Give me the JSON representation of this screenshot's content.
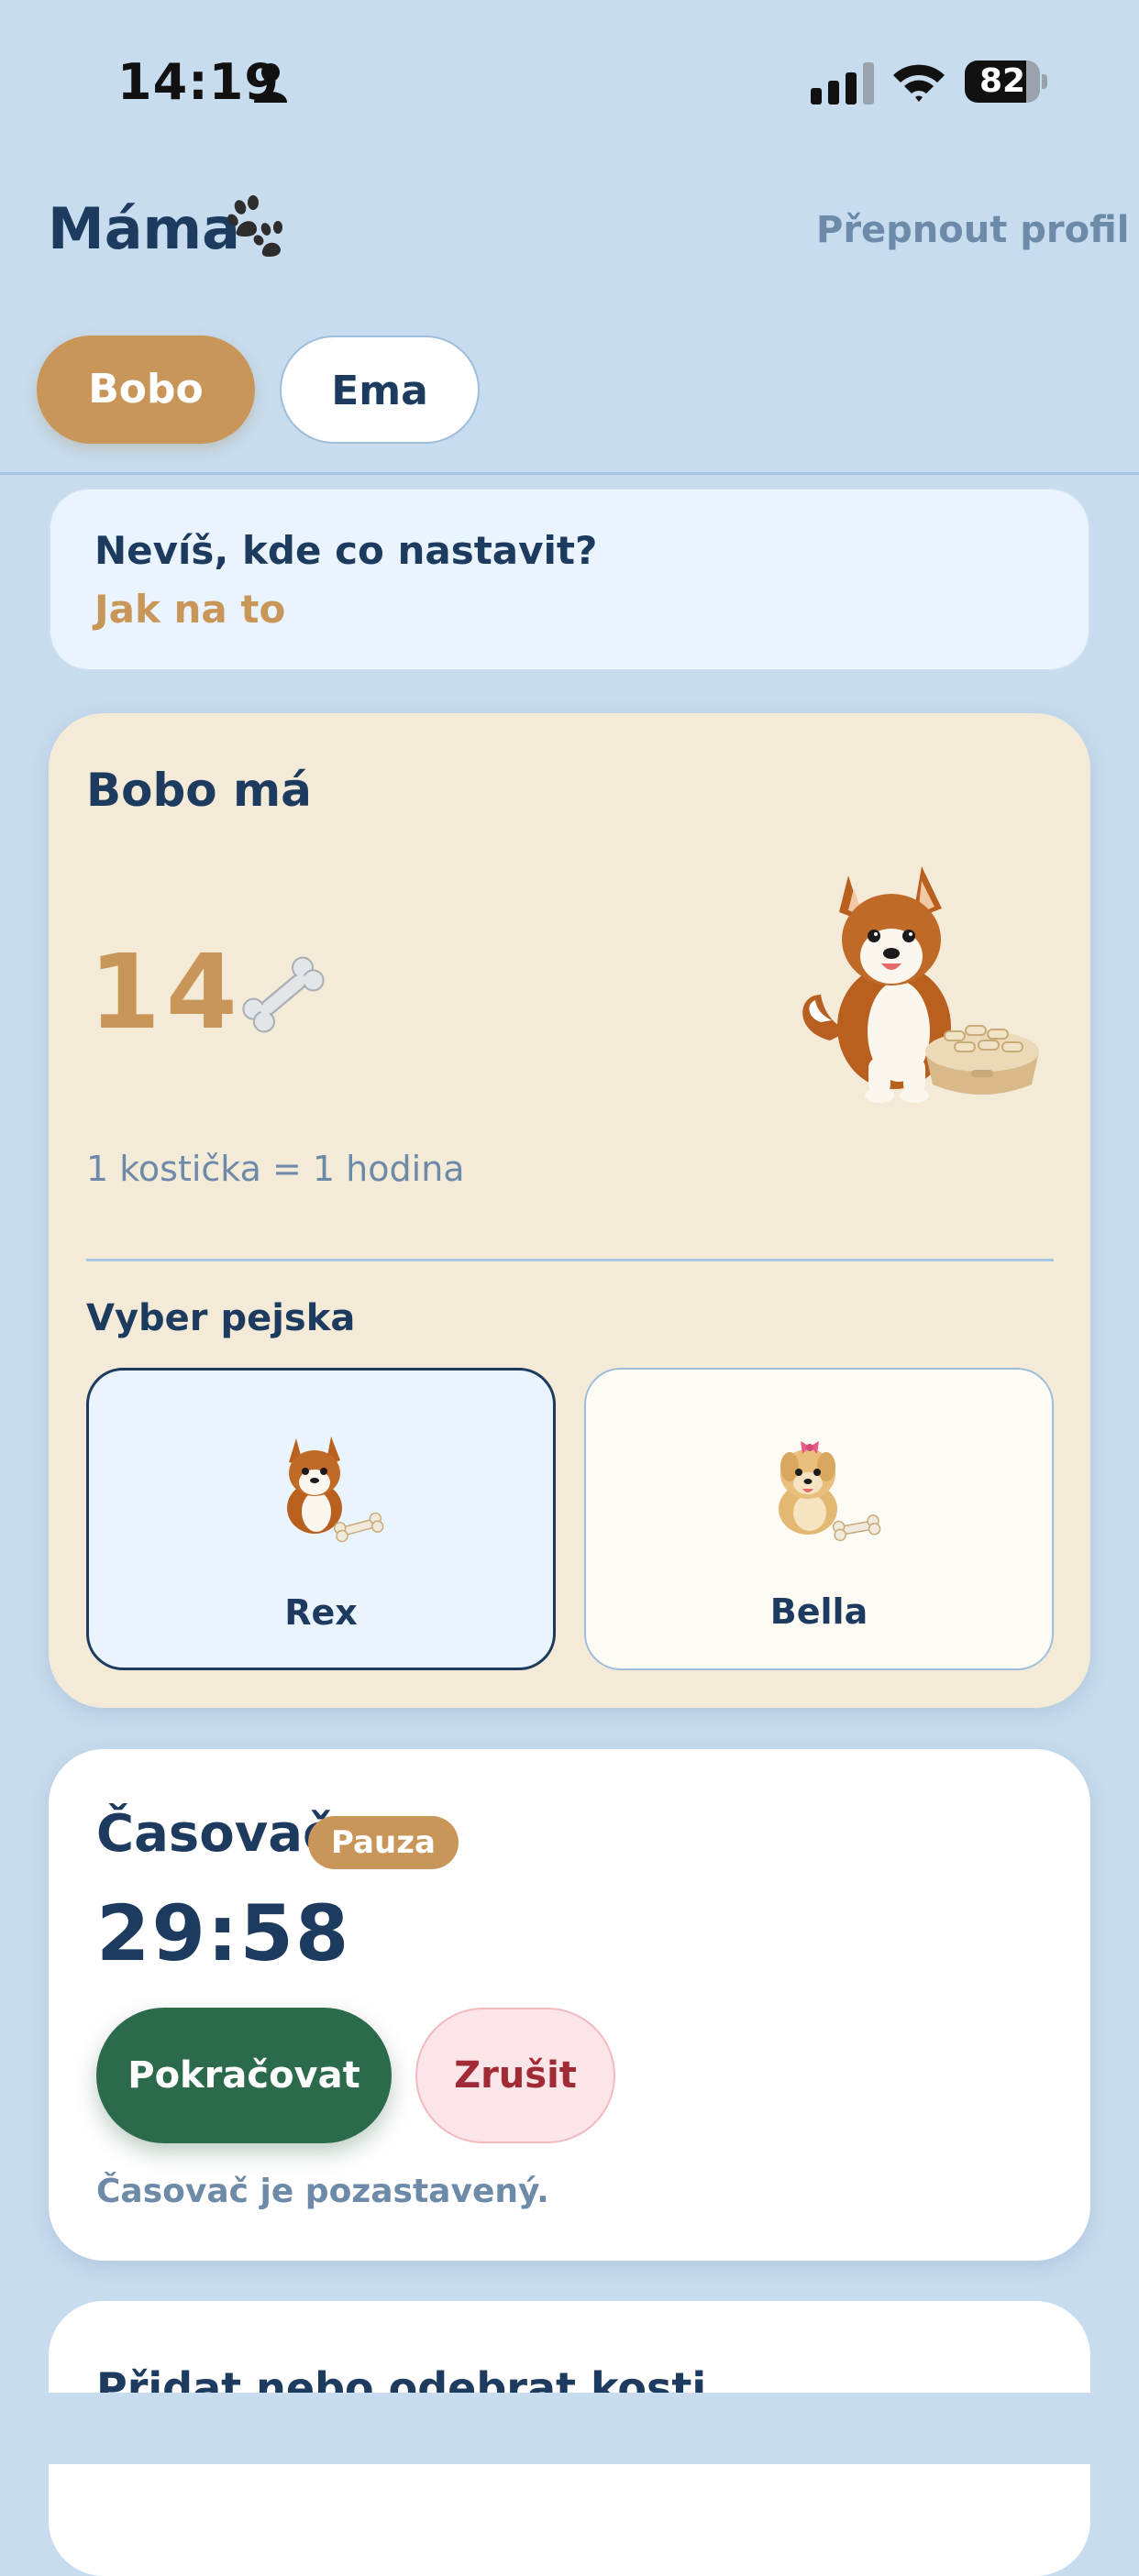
{
  "status_bar": {
    "time": "14:19",
    "battery": "82",
    "battery_level": 0.82
  },
  "header": {
    "title": "Máma",
    "switch_profile": "Přepnout profil"
  },
  "tabs": [
    {
      "label": "Bobo",
      "active": true
    },
    {
      "label": "Ema",
      "active": false
    }
  ],
  "help": {
    "question": "Nevíš, kde co nastavit?",
    "link": "Jak na to"
  },
  "bones": {
    "title": "Bobo má",
    "count": "14",
    "rate": "1 kostička = 1 hodina",
    "pick_label": "Vyber pejska",
    "dogs": [
      {
        "name": "Rex",
        "selected": true
      },
      {
        "name": "Bella",
        "selected": false
      }
    ]
  },
  "timer": {
    "title": "Časovač",
    "badge": "Pauza",
    "value": "29:58",
    "resume_label": "Pokračovat",
    "cancel_label": "Zrušit",
    "status": "Časovač je pozastavený."
  },
  "adjust": {
    "title": "Přidat nebo odebrat kosti"
  },
  "colors": {
    "background": "#c7dcee",
    "accent": "#c9965a",
    "primary_text": "#1d3a5f",
    "resume": "#2c6a4c",
    "cancel": "#a02a35"
  }
}
